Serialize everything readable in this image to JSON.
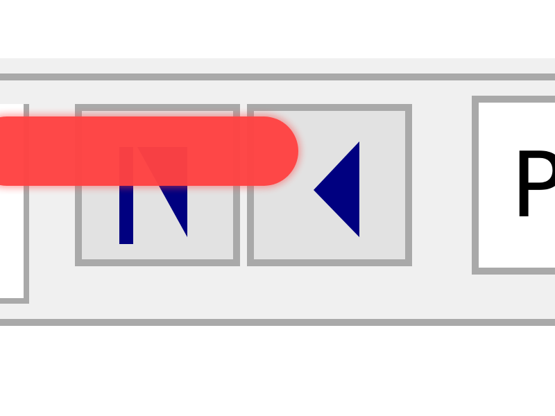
{
  "toolbar": {
    "first_page_button": {
      "icon": "first-page-icon"
    },
    "previous_page_button": {
      "icon": "previous-page-icon"
    },
    "page_input": {
      "value": "P"
    }
  },
  "colors": {
    "toolbar_background": "#f0f0f0",
    "border": "#a9a9a9",
    "button_face": "#e2e2e2",
    "arrow": "#000080",
    "highlight_stroke": "#ff4343"
  }
}
